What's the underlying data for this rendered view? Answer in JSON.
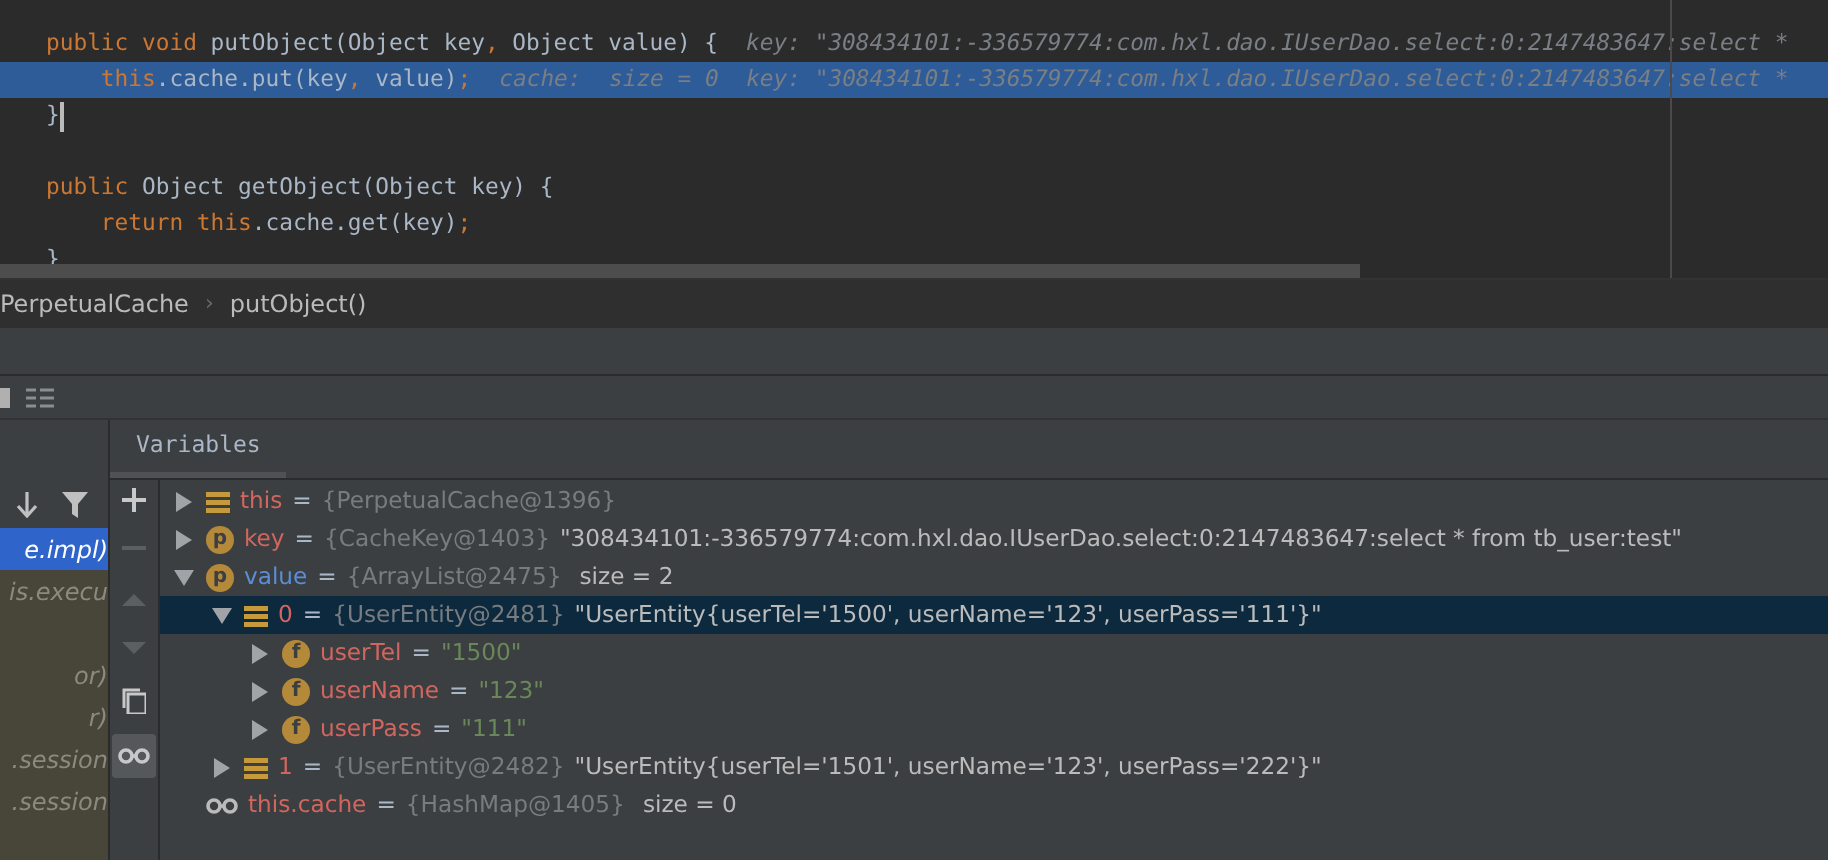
{
  "editor": {
    "lines": [
      {
        "highlighted": false,
        "caret": false,
        "segments": [
          {
            "kind": "keyword",
            "text": "public void "
          },
          {
            "kind": "plain",
            "text": "putObject(Object key"
          },
          {
            "kind": "keyword",
            "text": ","
          },
          {
            "kind": "plain",
            "text": " Object value) {"
          },
          {
            "kind": "hint",
            "text": "key: \"308434101:-336579774:com.hxl.dao.IUserDao.select:0:2147483647:select *"
          }
        ]
      },
      {
        "highlighted": true,
        "caret": false,
        "segments": [
          {
            "kind": "keyword",
            "text": "    this"
          },
          {
            "kind": "plain",
            "text": ".cache.put(key"
          },
          {
            "kind": "keyword",
            "text": ","
          },
          {
            "kind": "plain",
            "text": " value)"
          },
          {
            "kind": "keyword",
            "text": ";"
          },
          {
            "kind": "hint",
            "text": "cache:  size = 0  key: \"308434101:-336579774:com.hxl.dao.IUserDao.select:0:2147483647:select *"
          }
        ]
      },
      {
        "highlighted": false,
        "caret": true,
        "segments": [
          {
            "kind": "plain",
            "text": "}"
          }
        ]
      },
      {
        "highlighted": false,
        "caret": false
      },
      {
        "highlighted": false,
        "caret": false,
        "segments": [
          {
            "kind": "keyword",
            "text": "public"
          },
          {
            "kind": "plain",
            "text": " Object getObject(Object key) {"
          }
        ]
      },
      {
        "highlighted": false,
        "caret": false,
        "segments": [
          {
            "kind": "keyword",
            "text": "    return this"
          },
          {
            "kind": "plain",
            "text": ".cache.get(key)"
          },
          {
            "kind": "keyword",
            "text": ";"
          }
        ]
      },
      {
        "highlighted": false,
        "caret": false,
        "segments": [
          {
            "kind": "plain",
            "text": "}"
          }
        ]
      }
    ]
  },
  "breadcrumb": {
    "separator": "›",
    "items": [
      "PerpetualCache",
      "putObject()"
    ]
  },
  "frames": {
    "items": [
      {
        "text": "e.impl)",
        "selected": true
      },
      {
        "text": "is.execu",
        "selected": false
      },
      {
        "selected": false
      },
      {
        "text": "or)",
        "selected": false
      },
      {
        "text": "r)",
        "selected": false
      },
      {
        "text": ".session",
        "selected": false
      },
      {
        "text": ".session",
        "selected": false
      }
    ]
  },
  "variables": {
    "tab": "Variables",
    "operator": "=",
    "tree": [
      {
        "kind": "object",
        "name": "this",
        "changed": false,
        "expanded": false,
        "selected": false,
        "type": "{PerpetualCache@1396}"
      },
      {
        "kind": "p",
        "name": "key",
        "changed": false,
        "expanded": false,
        "selected": false,
        "type": "{CacheKey@1403}",
        "value": "\"308434101:-336579774:com.hxl.dao.IUserDao.select:0:2147483647:select * from tb_user:test\""
      },
      {
        "kind": "p",
        "name": "value",
        "changed": true,
        "expanded": true,
        "selected": false,
        "type": "{ArrayList@2475}",
        "extra": "size = 2",
        "children": [
          {
            "kind": "object",
            "name": "0",
            "changed": false,
            "expanded": true,
            "selected": true,
            "type": "{UserEntity@2481}",
            "value": "\"UserEntity{userTel='1500', userName='123', userPass='111'}\"",
            "children": [
              {
                "kind": "f",
                "name": "userTel",
                "changed": false,
                "expanded": false,
                "selected": false,
                "string": "\"1500\""
              },
              {
                "kind": "f",
                "name": "userName",
                "changed": false,
                "expanded": false,
                "selected": false,
                "string": "\"123\""
              },
              {
                "kind": "f",
                "name": "userPass",
                "changed": false,
                "expanded": false,
                "selected": false,
                "string": "\"111\""
              }
            ]
          },
          {
            "kind": "object",
            "name": "1",
            "changed": false,
            "expanded": false,
            "selected": false,
            "type": "{UserEntity@2482}",
            "value": "\"UserEntity{userTel='1501', userName='123', userPass='222'}\""
          }
        ]
      },
      {
        "kind": "watch",
        "name": "this.cache",
        "changed": false,
        "selected": false,
        "type": "{HashMap@1405}",
        "extra": "size = 0"
      }
    ]
  }
}
